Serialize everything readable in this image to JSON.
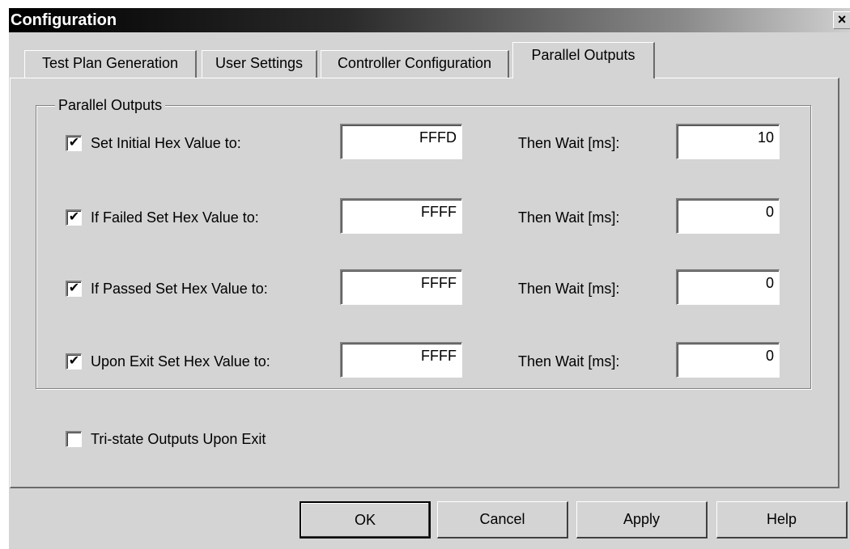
{
  "window": {
    "title": "Configuration",
    "close_glyph": "×"
  },
  "tabs": [
    {
      "label": "Test Plan Generation",
      "active": false
    },
    {
      "label": "User Settings",
      "active": false
    },
    {
      "label": "Controller Configuration",
      "active": false
    },
    {
      "label": "Parallel Outputs",
      "active": true
    }
  ],
  "group": {
    "title": "Parallel Outputs",
    "rows": [
      {
        "checked": true,
        "label": "Set Initial Hex Value to:",
        "hex_value": "FFFD",
        "wait_label": "Then Wait [ms]:",
        "wait_value": "10"
      },
      {
        "checked": true,
        "label": "If Failed Set Hex Value to:",
        "hex_value": "FFFF",
        "wait_label": "Then Wait [ms]:",
        "wait_value": "0"
      },
      {
        "checked": true,
        "label": "If Passed Set Hex Value to:",
        "hex_value": "FFFF",
        "wait_label": "Then Wait [ms]:",
        "wait_value": "0"
      },
      {
        "checked": true,
        "label": "Upon Exit Set Hex Value to:",
        "hex_value": "FFFF",
        "wait_label": "Then Wait [ms]:",
        "wait_value": "0"
      }
    ]
  },
  "tristate": {
    "checked": false,
    "label": "Tri-state Outputs Upon Exit"
  },
  "check_glyph": "✔",
  "buttons": {
    "ok": "OK",
    "cancel": "Cancel",
    "apply": "Apply",
    "help": "Help"
  }
}
